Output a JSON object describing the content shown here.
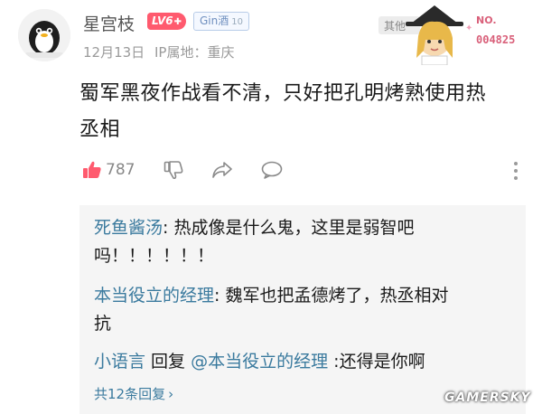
{
  "post": {
    "username": "星宫枝",
    "level_badge": "LV6",
    "fan_badge": "Gin酒",
    "fan_badge_level": "10",
    "date": "12月13日",
    "ip_location": "IP属地：重庆",
    "sticker_text": "其他",
    "sticker_no_label": "NO.",
    "sticker_number": "004825",
    "content_line1": "蜀军黑夜作战看不清，只好把孔明烤熟使用热",
    "content_line2": "丞相",
    "like_count": "787"
  },
  "replies": {
    "items": [
      {
        "name": "死鱼酱汤",
        "sep": ": ",
        "text_line1": "热成像是什么鬼，这里是弱智吧",
        "text_line2": "吗！！！！！！"
      },
      {
        "name": "本当役立的经理",
        "sep": ": ",
        "text_line1": "魏军也把孟德烤了，热丞相对",
        "text_line2": "抗"
      },
      {
        "name": "小语言",
        "mid": " 回复 ",
        "target": "@本当役立的经理",
        "text": " :还得是你啊"
      }
    ],
    "count_label": "共12条回复",
    "count_arrow": "›"
  },
  "watermark": "GAMERSKY",
  "colors": {
    "link": "#3a7a9e",
    "like": "#ff5a6e",
    "level_badge": "#ff5a6e",
    "meta": "#9a9a9a"
  }
}
